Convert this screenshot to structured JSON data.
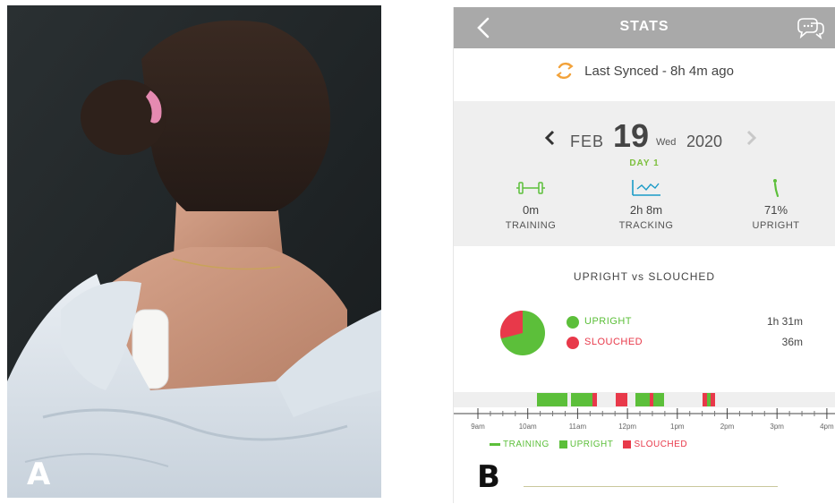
{
  "figure": {
    "panel_a_label": "A",
    "panel_b_label": "B"
  },
  "app": {
    "header": {
      "title": "STATS",
      "back_icon": "chevron-left-icon",
      "chat_icon": "chat-bubbles-icon"
    },
    "sync": {
      "icon": "sync-icon",
      "text": "Last Synced - 8h 4m ago",
      "color": "#f2a23a"
    },
    "date": {
      "month": "FEB",
      "day": "19",
      "weekday": "Wed",
      "year": "2020",
      "day_label": "DAY 1",
      "prev_icon": "chevron-left-icon",
      "next_icon": "chevron-right-icon"
    },
    "stats": [
      {
        "icon": "dumbbell-icon",
        "value": "0m",
        "label": "TRAINING"
      },
      {
        "icon": "tracking-chart-icon",
        "value": "2h 8m",
        "label": "TRACKING"
      },
      {
        "icon": "upright-figure-icon",
        "value": "71%",
        "label": "UPRIGHT"
      }
    ],
    "posture": {
      "title": "UPRIGHT vs SLOUCHED",
      "upright_label": "UPRIGHT",
      "upright_value": "1h 31m",
      "slouched_label": "SLOUCHED",
      "slouched_value": "36m",
      "upright_fraction": 0.71
    },
    "timeline": {
      "ticks": [
        "9am",
        "10am",
        "11am",
        "12pm",
        "1pm",
        "2pm",
        "3pm",
        "4pm"
      ],
      "legend": {
        "training": "TRAINING",
        "upright": "UPRIGHT",
        "slouched": "SLOUCHED"
      }
    },
    "colors": {
      "header": "#a9a9a9",
      "green": "#5cbf3a",
      "red": "#e8394a",
      "panel_gray": "#efefef",
      "tracking_blue": "#1a9bc7"
    }
  }
}
